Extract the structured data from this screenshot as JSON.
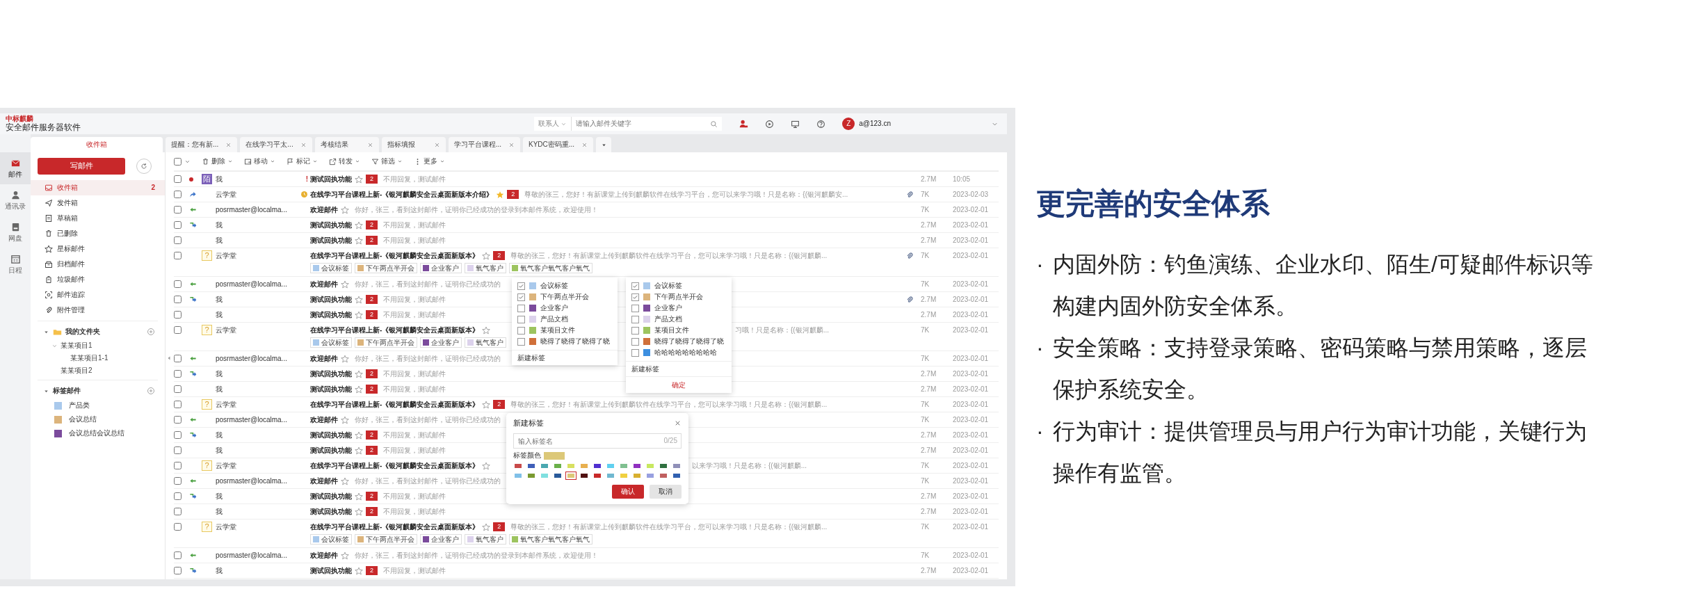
{
  "header": {
    "logo": "中标麒麟",
    "product": "安全邮件服务器软件",
    "search": {
      "scope": "联系人",
      "placeholder": "请输入邮件关键字"
    },
    "avatar": "Z",
    "email": "a@123.cn"
  },
  "rail": [
    {
      "label": "邮件",
      "kind": "mail",
      "selected": true
    },
    {
      "label": "通讯录",
      "kind": "contacts",
      "selected": false
    },
    {
      "label": "网盘",
      "kind": "disk",
      "selected": false
    },
    {
      "label": "日程",
      "kind": "calendar",
      "selected": false
    }
  ],
  "tabs": [
    {
      "label": "收件箱",
      "selected": true,
      "closable": false
    },
    {
      "label": "提醒：您有新...",
      "selected": false,
      "closable": true
    },
    {
      "label": "在线学习平太...",
      "selected": false,
      "closable": true
    },
    {
      "label": "考核结果",
      "selected": false,
      "closable": true
    },
    {
      "label": "指标填报",
      "selected": false,
      "closable": true
    },
    {
      "label": "学习平台课程...",
      "selected": false,
      "closable": true
    },
    {
      "label": "KYDC密码重...",
      "selected": false,
      "closable": true
    }
  ],
  "sidebar": {
    "compose": "写邮件",
    "items": [
      {
        "label": "收件箱",
        "kind": "inbox",
        "count": "2",
        "selected": true
      },
      {
        "label": "发件箱",
        "kind": "outbox",
        "selected": false
      },
      {
        "label": "草稿箱",
        "kind": "draft",
        "selected": false
      },
      {
        "label": "已删除",
        "kind": "deleted",
        "selected": false
      },
      {
        "label": "星标邮件",
        "kind": "starred",
        "selected": false
      },
      {
        "label": "归档邮件",
        "kind": "archive",
        "selected": false
      },
      {
        "label": "垃圾邮件",
        "kind": "spam",
        "selected": false
      },
      {
        "label": "邮件追踪",
        "kind": "tracking",
        "selected": false
      },
      {
        "label": "附件管理",
        "kind": "attachments",
        "selected": false
      }
    ],
    "folders": {
      "title": "我的文件夹",
      "expanded": true,
      "children": [
        {
          "label": "某某项目1",
          "expanded": true,
          "children": [
            {
              "label": "某某项目1-1"
            }
          ]
        },
        {
          "label": "某某项目2"
        }
      ]
    },
    "tags": {
      "title": "标签邮件",
      "expanded": true,
      "items": [
        {
          "label": "产品类",
          "color": "#a9c9ec"
        },
        {
          "label": "会议总结",
          "color": "#dcb47c"
        },
        {
          "label": "会议总结会议总结",
          "color": "#7b4b9c"
        }
      ]
    }
  },
  "select_all": {
    "checked": false
  },
  "toolbar": [
    {
      "label": "删除",
      "kind": "delete"
    },
    {
      "label": "移动",
      "kind": "move"
    },
    {
      "label": "标记",
      "kind": "mark"
    },
    {
      "label": "转发",
      "kind": "forward"
    },
    {
      "label": "筛选",
      "kind": "filter"
    },
    {
      "label": "更多",
      "kind": "more"
    }
  ],
  "messages": [
    {
      "checked": false,
      "unread": true,
      "kind": "none",
      "flag": {
        "kind": "stranger",
        "text": "陌"
      },
      "sender": "我",
      "priority": "!",
      "reminder": false,
      "subject": "测试回执功能",
      "starred": false,
      "badge": "2",
      "preview": "不用回复，测试邮件",
      "attachment": false,
      "size": "2.7M",
      "date": "10:05"
    },
    {
      "checked": false,
      "unread": false,
      "kind": "reply",
      "sender": "云学堂",
      "reminder": true,
      "subject": "在线学习平台课程上新-《银河麒麟安全云桌面新版本介绍》",
      "starred": true,
      "badge": "2",
      "preview": "尊敬的张三，您好！有新课堂上传到麒麟软件在线学习平台，您可以来学习哦！只是名称：{(银河麒麟安...",
      "attachment": true,
      "size": "7K",
      "date": "2023-02-03"
    },
    {
      "checked": false,
      "unread": false,
      "kind": "back",
      "sender": "posrmaster@localma...",
      "reminder": false,
      "subject": "欢迎邮件",
      "starred": false,
      "preview": "你好，张三，看到这封邮件，证明你已经成功的登录到本邮件系统，欢迎使用！",
      "attachment": false,
      "size": "7K",
      "date": "2023-02-01"
    },
    {
      "checked": false,
      "unread": false,
      "kind": "forward",
      "sender": "我",
      "reminder": false,
      "subject": "测试回执功能",
      "starred": false,
      "badge": "2",
      "preview": "不用回复，测试邮件",
      "attachment": false,
      "size": "2.7M",
      "date": "2023-02-01"
    },
    {
      "checked": false,
      "unread": false,
      "kind": "none",
      "sender": "我",
      "reminder": false,
      "subject": "测试回执功能",
      "starred": false,
      "badge": "2",
      "preview": "不用回复，测试邮件",
      "attachment": false,
      "size": "2.7M",
      "date": "2023-02-01"
    },
    {
      "checked": false,
      "unread": false,
      "kind": "none",
      "flag": {
        "kind": "suspicious",
        "text": "?"
      },
      "sender": "云学堂",
      "reminder": false,
      "subject": "在线学习平台课程上新-《银河麒麟安全云桌面新版本》",
      "starred": false,
      "badge": "2",
      "preview": "尊敬的张三，您好！有新课堂上传到麒麟软件在线学习平台，您可以来学习哦！只是名称：{(银河麒麟...",
      "attachment": true,
      "size": "7K",
      "date": "2023-02-01",
      "tags": [
        {
          "label": "会议标签",
          "color": "#a9c9ec"
        },
        {
          "label": "下午两点半开会",
          "color": "#dcb47c"
        },
        {
          "label": "企业客户",
          "color": "#7b4b9c"
        },
        {
          "label": "氧气客户",
          "color": "#dcd2ec"
        },
        {
          "label": "氧气客户氧气客户氧气",
          "color": "#9dc45f"
        }
      ]
    },
    {
      "checked": false,
      "unread": false,
      "kind": "back",
      "sender": "posrmaster@localma...",
      "reminder": false,
      "subject": "欢迎邮件",
      "starred": false,
      "preview": "你好，张三，看到这封邮件，证明你已经成功的",
      "attachment": false,
      "size": "7K",
      "date": "2023-02-01"
    },
    {
      "checked": false,
      "unread": false,
      "kind": "forward",
      "sender": "我",
      "reminder": false,
      "subject": "测试回执功能",
      "starred": false,
      "badge": "2",
      "preview": "不用回复，测试邮件",
      "attachment": true,
      "size": "2.7M",
      "date": "2023-02-01"
    },
    {
      "checked": false,
      "unread": false,
      "kind": "none",
      "sender": "我",
      "reminder": false,
      "subject": "测试回执功能",
      "starred": false,
      "badge": "2",
      "preview": "不用回复，测试邮件",
      "attachment": false,
      "size": "2.7M",
      "date": "2023-02-01"
    },
    {
      "checked": false,
      "unread": false,
      "kind": "none",
      "flag": {
        "kind": "suspicious",
        "text": "?"
      },
      "sender": "云学堂",
      "reminder": false,
      "subject": "在线学习平台课程上新-《银河麒麟安全云桌面新版本》",
      "starred": false,
      "preview": {
        "kind": "tail",
        "text": "习哦！只是名称：{(银河麒麟..."
      },
      "attachment": false,
      "size": "7K",
      "date": "2023-02-01",
      "tags": [
        {
          "label": "会议标签",
          "color": "#a9c9ec"
        },
        {
          "label": "下午两点半开会",
          "color": "#dcb47c"
        },
        {
          "label": "企业客户",
          "color": "#7b4b9c"
        },
        {
          "label": "氧气客户",
          "color": "#dcd2ec"
        }
      ]
    },
    {
      "checked": false,
      "unread": false,
      "kind": "back",
      "sender": "posrmaster@localma...",
      "reminder": false,
      "subject": "欢迎邮件",
      "starred": false,
      "preview": "你好，张三，看到这封邮件，证明你已经成功的",
      "attachment": false,
      "size": "7K",
      "date": "2023-02-01"
    },
    {
      "checked": false,
      "unread": false,
      "kind": "forward",
      "sender": "我",
      "reminder": false,
      "subject": "测试回执功能",
      "starred": false,
      "badge": "2",
      "preview": "不用回复，测试邮件",
      "attachment": false,
      "size": "2.7M",
      "date": "2023-02-01"
    },
    {
      "checked": false,
      "unread": false,
      "kind": "none",
      "sender": "我",
      "reminder": false,
      "subject": "测试回执功能",
      "starred": false,
      "badge": "2",
      "preview": "不用回复，测试邮件",
      "attachment": false,
      "size": "2.7M",
      "date": "2023-02-01"
    },
    {
      "checked": false,
      "unread": false,
      "kind": "none",
      "flag": {
        "kind": "suspicious",
        "text": "?"
      },
      "sender": "云学堂",
      "reminder": false,
      "subject": "在线学习平台课程上新-《银河麒麟安全云桌面新版本》",
      "starred": false,
      "badge": "2",
      "preview": "尊敬的张三，您好！有新课堂上传到麒麟软件在线学习平台，您可以来学习哦！只是名称：{(银河麒麟...",
      "attachment": false,
      "size": "7K",
      "date": "2023-02-01"
    },
    {
      "checked": false,
      "unread": false,
      "kind": "back",
      "sender": "posrmaster@localma...",
      "reminder": false,
      "subject": "欢迎邮件",
      "starred": false,
      "preview": "你好，张三，看到这封邮件，证明你已经成功的",
      "attachment": false,
      "size": "7K",
      "date": "2023-02-01"
    },
    {
      "checked": false,
      "unread": false,
      "kind": "forward",
      "sender": "我",
      "reminder": false,
      "subject": "测试回执功能",
      "starred": false,
      "badge": "2",
      "preview": "不用回复，测试邮件",
      "attachment": false,
      "size": "2.7M",
      "date": "2023-02-01"
    },
    {
      "checked": false,
      "unread": false,
      "kind": "none",
      "sender": "我",
      "reminder": false,
      "subject": "测试回执功能",
      "starred": false,
      "badge": "2",
      "preview": "不用回复，测试邮件",
      "attachment": false,
      "size": "2.7M",
      "date": "2023-02-01"
    },
    {
      "checked": false,
      "unread": false,
      "kind": "none",
      "flag": {
        "kind": "suspicious",
        "text": "?"
      },
      "sender": "云学堂",
      "reminder": false,
      "subject": "在线学习平台课程上新-《银河麒麟安全云桌面新版本》",
      "starred": false,
      "preview": {
        "kind": "tail",
        "text": "以来学习哦！只是名称：{(银河麒麟..."
      },
      "attachment": false,
      "size": "7K",
      "date": "2023-02-01"
    },
    {
      "checked": false,
      "unread": false,
      "kind": "back",
      "sender": "posrmaster@localma...",
      "reminder": false,
      "subject": "欢迎邮件",
      "starred": false,
      "preview": "你好，张三，看到这封邮件，证明你已经成功的",
      "attachment": false,
      "size": "7K",
      "date": "2023-02-01"
    },
    {
      "checked": false,
      "unread": false,
      "kind": "forward",
      "sender": "我",
      "reminder": false,
      "subject": "测试回执功能",
      "starred": false,
      "badge": "2",
      "preview": "不用回复，测试邮件",
      "attachment": false,
      "size": "2.7M",
      "date": "2023-02-01"
    },
    {
      "checked": false,
      "unread": false,
      "kind": "none",
      "sender": "我",
      "reminder": false,
      "subject": "测试回执功能",
      "starred": false,
      "badge": "2",
      "preview": "不用回复，测试邮件",
      "attachment": false,
      "size": "2.7M",
      "date": "2023-02-01"
    },
    {
      "checked": false,
      "unread": false,
      "kind": "none",
      "flag": {
        "kind": "suspicious",
        "text": "?"
      },
      "sender": "云学堂",
      "reminder": false,
      "subject": "在线学习平台课程上新-《银河麒麟安全云桌面新版本》",
      "starred": false,
      "badge": "2",
      "preview": "尊敬的张三，您好！有新课堂上传到麒麟软件在线学习平台，您可以来学习哦！只是名称：{(银河麒麟...",
      "attachment": false,
      "size": "7K",
      "date": "2023-02-01",
      "tags": [
        {
          "label": "会议标签",
          "color": "#a9c9ec"
        },
        {
          "label": "下午两点半开会",
          "color": "#dcb47c"
        },
        {
          "label": "企业客户",
          "color": "#7b4b9c"
        },
        {
          "label": "氧气客户",
          "color": "#dcd2ec"
        },
        {
          "label": "氧气客户氧气客户氧气",
          "color": "#9dc45f"
        }
      ]
    },
    {
      "checked": false,
      "unread": false,
      "kind": "back",
      "sender": "posrmaster@localma...",
      "reminder": false,
      "subject": "欢迎邮件",
      "starred": false,
      "preview": "你好，张三，看到这封邮件，证明你已经成功的登录到本邮件系统，欢迎使用！",
      "attachment": false,
      "size": "7K",
      "date": "2023-02-01"
    },
    {
      "checked": false,
      "unread": false,
      "kind": "forward",
      "sender": "我",
      "reminder": false,
      "subject": "测试回执功能",
      "starred": false,
      "badge": "2",
      "preview": "不用回复，测试邮件",
      "attachment": false,
      "size": "2.7M",
      "date": "2023-02-01"
    }
  ],
  "tag_menus": [
    {
      "items": [
        {
          "label": "会议标签",
          "color": "#a9c9ec",
          "checked": true
        },
        {
          "label": "下午两点半开会",
          "color": "#dcb47c",
          "checked": true
        },
        {
          "label": "企业客户",
          "color": "#7b4b9c",
          "checked": false
        },
        {
          "label": "产品文档",
          "color": "#dcd2ec",
          "checked": false
        },
        {
          "label": "某项目文件",
          "color": "#9dc45f",
          "checked": false
        },
        {
          "label": "晓得了晓得了晓得了晓",
          "color": "#d0703a",
          "checked": false
        }
      ],
      "new_label": "新建标签"
    },
    {
      "items": [
        {
          "label": "会议标签",
          "color": "#a9c9ec",
          "checked": true
        },
        {
          "label": "下午两点半开会",
          "color": "#dcb47c",
          "checked": true
        },
        {
          "label": "企业客户",
          "color": "#7b4b9c",
          "checked": false
        },
        {
          "label": "产品文档",
          "color": "#dcd2ec",
          "checked": false
        },
        {
          "label": "某项目文件",
          "color": "#9dc45f",
          "checked": false
        },
        {
          "label": "晓得了晓得了晓得了晓",
          "color": "#d0703a",
          "checked": false
        },
        {
          "label": "哈哈哈哈哈哈哈哈哈",
          "color": "#3d8fe0",
          "checked": false
        }
      ],
      "new_label": "新建标签",
      "confirm": "确定"
    }
  ],
  "dialog": {
    "title": "新建标签",
    "placeholder": "输入标签名",
    "counter": "0/25",
    "color_label": "标签颜色",
    "colors": [
      {
        "color": "#c84a4a",
        "selected": false
      },
      {
        "color": "#3f5fb8",
        "selected": false
      },
      {
        "color": "#4aa8b0",
        "selected": false
      },
      {
        "color": "#6ab04a",
        "selected": false
      },
      {
        "color": "#d8e060",
        "selected": false
      },
      {
        "color": "#e8b050",
        "selected": false
      },
      {
        "color": "#5030d0",
        "selected": false
      },
      {
        "color": "#60d0f0",
        "selected": false
      },
      {
        "color": "#80c090",
        "selected": false
      },
      {
        "color": "#9030c0",
        "selected": false
      },
      {
        "color": "#c8e860",
        "selected": false
      },
      {
        "color": "#307040",
        "selected": false
      },
      {
        "color": "#9090b8",
        "selected": false
      },
      {
        "color": "#80c0e8",
        "selected": false
      },
      {
        "color": "#7a9a30",
        "selected": false
      },
      {
        "color": "#80e0e0",
        "selected": false
      },
      {
        "color": "#2a5a9a",
        "selected": false
      },
      {
        "color": "#dcc878",
        "selected": true
      },
      {
        "color": "#501010",
        "selected": false
      },
      {
        "color": "#c82a2a",
        "selected": false
      },
      {
        "color": "#70b8d0",
        "selected": false
      },
      {
        "color": "#f0d040",
        "selected": false
      },
      {
        "color": "#d8b030",
        "selected": false
      },
      {
        "color": "#98a0e0",
        "selected": false
      },
      {
        "color": "#c06060",
        "selected": false
      },
      {
        "color": "#3060b0",
        "selected": false
      }
    ],
    "buttons": [
      {
        "label": "确认",
        "kind": "primary"
      },
      {
        "label": "取消",
        "kind": "secondary"
      }
    ]
  },
  "promo": {
    "title": "更完善的安全体系",
    "points": [
      {
        "bullet": "·",
        "text": "内固外防：钓鱼演练、企业水印、陌生/可疑邮件标识等构建内固外防安全体系。"
      },
      {
        "bullet": "·",
        "text": "安全策略：支持登录策略、密码策略与禁用策略，逐层保护系统安全。"
      },
      {
        "bullet": "·",
        "text": "行为审计：提供管理员与用户行为审计功能，关键行为操作有监管。"
      }
    ]
  }
}
